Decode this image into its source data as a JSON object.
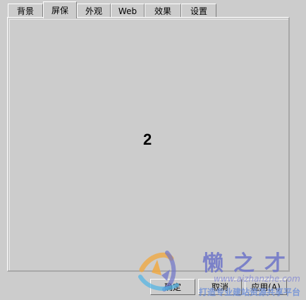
{
  "tabs": [
    {
      "label": "背景",
      "active": false
    },
    {
      "label": "屏保",
      "active": true
    },
    {
      "label": "外观",
      "active": false
    },
    {
      "label": "Web",
      "active": false
    },
    {
      "label": "效果",
      "active": false
    },
    {
      "label": "设置",
      "active": false
    }
  ],
  "panel": {
    "page_number": "2"
  },
  "buttons": {
    "ok_label": "确定",
    "cancel_label": "取消",
    "apply_label": "应用(A)"
  },
  "watermark": {
    "title": "懒之才",
    "url": "www.aizhanzhe.com",
    "slogan": "打造专业建站资源共享平台",
    "colors": [
      "#6d74c8",
      "#f2a73b",
      "#4fb4e6"
    ]
  }
}
